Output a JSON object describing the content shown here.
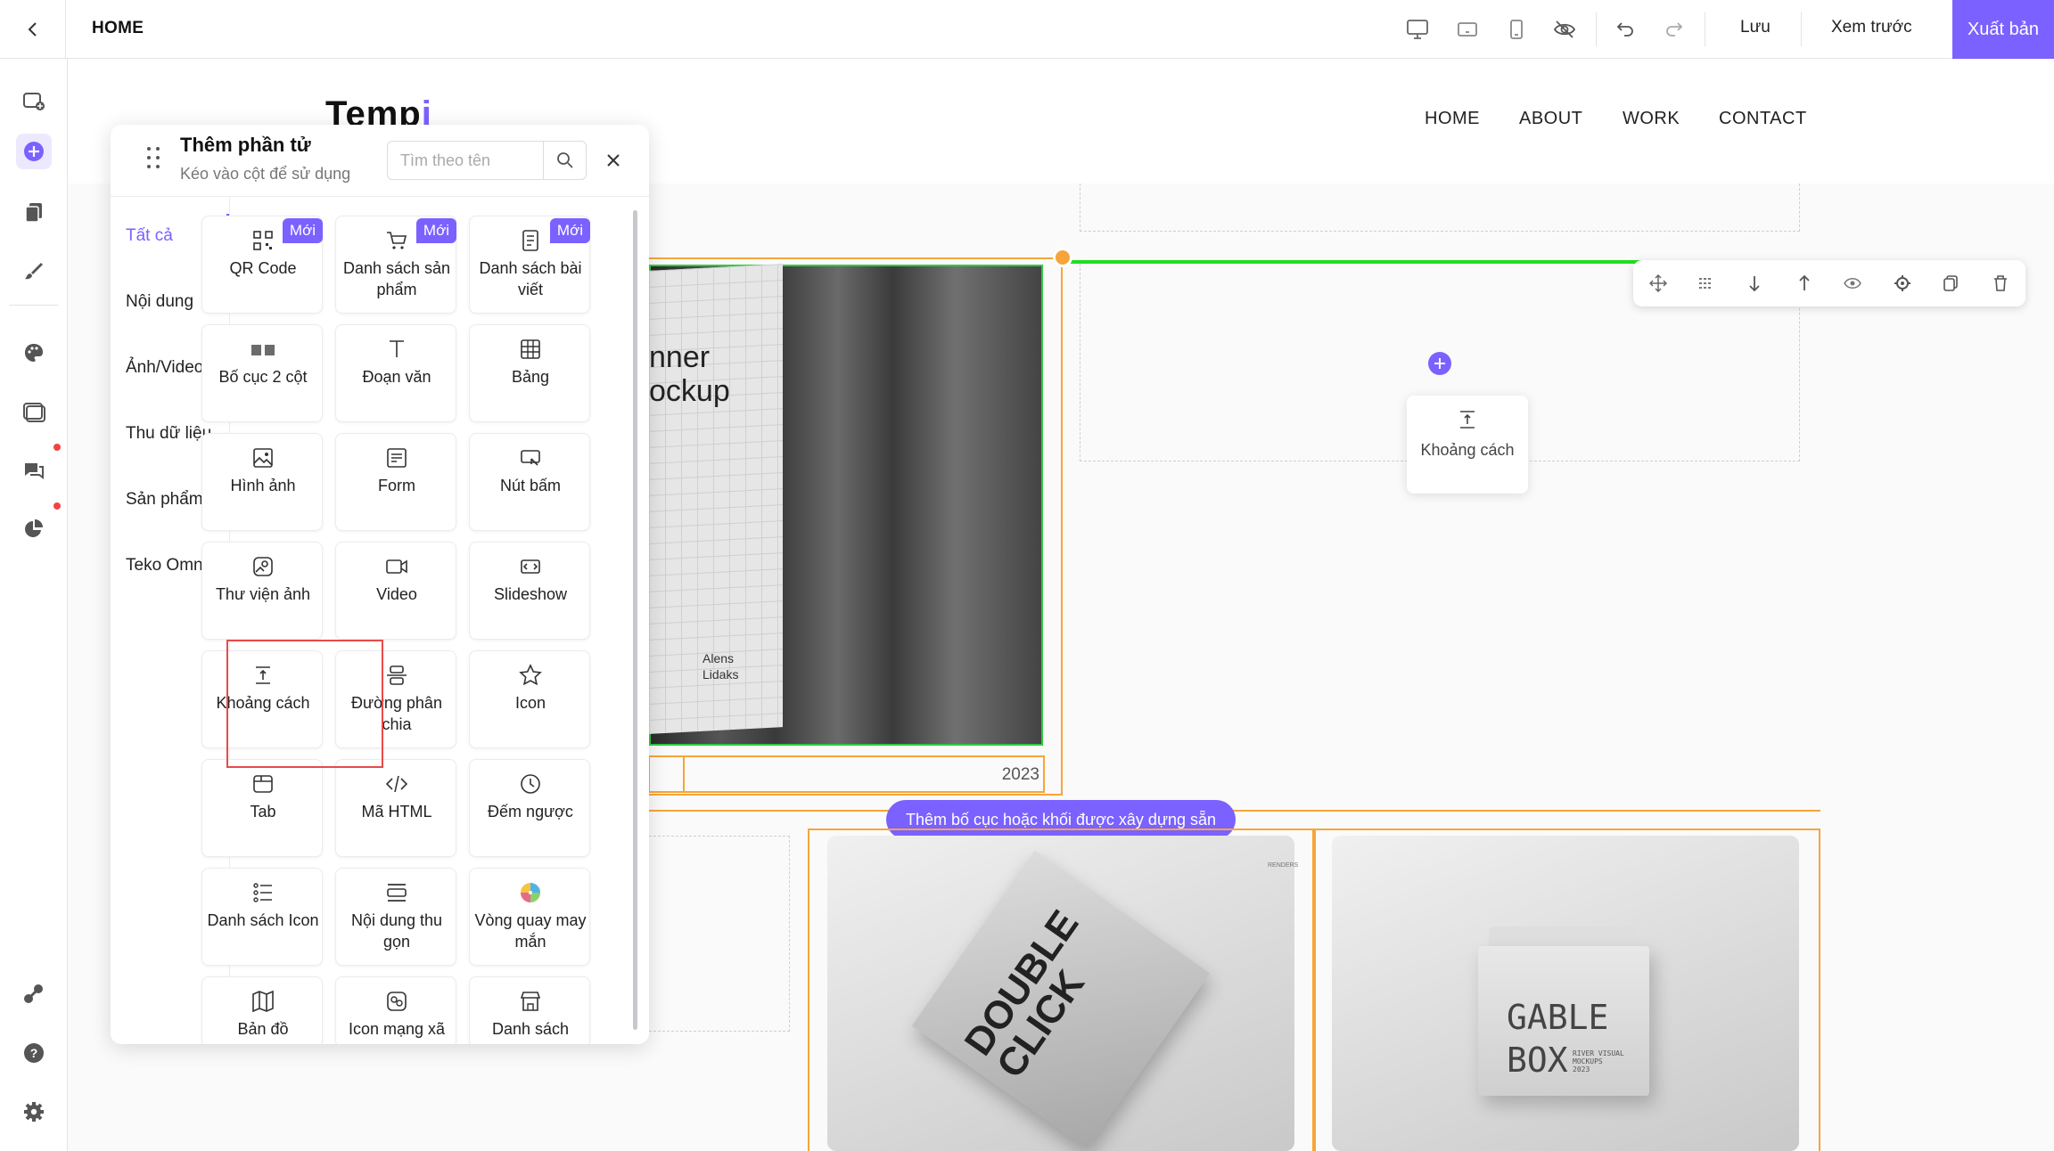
{
  "topbar": {
    "page_name": "HOME",
    "save_label": "Lưu",
    "preview_label": "Xem trước",
    "publish_label": "Xuất bản"
  },
  "site": {
    "logo": "Temp",
    "logo_accent": "i",
    "nav": [
      "HOME",
      "ABOUT",
      "WORK",
      "CONTACT"
    ],
    "banner_line1": "nner",
    "banner_line2": "ockup",
    "banner_author": "Alens\nLidaks",
    "year": "2023",
    "add_layout_label": "Thêm bố cục hoặc khối được xây dựng sẵn",
    "drag_card_label": "Khoảng cách",
    "double_click": "DOUBLE\nCLICK",
    "gable_box": "GABLE\nBOX",
    "gable_box_small": "RIVER VISUAL\nMOCKUPS\n2023",
    "renders_small": "RENDERS"
  },
  "panel": {
    "title": "Thêm phần tử",
    "subtitle": "Kéo vào cột để sử dụng",
    "search_placeholder": "Tìm theo tên",
    "categories": [
      "Tất cả",
      "Nội dung",
      "Ảnh/Video",
      "Thu dữ liệu",
      "Sản phẩm",
      "Teko Omni"
    ],
    "badge_label": "Mới",
    "tiles": [
      {
        "label": "QR Code",
        "icon": "qr-icon",
        "badge": true
      },
      {
        "label": "Danh sách sản phẩm",
        "icon": "cart-icon",
        "badge": true
      },
      {
        "label": "Danh sách bài viết",
        "icon": "document-icon",
        "badge": true
      },
      {
        "label": "Bố cục 2 cột",
        "icon": "two-columns-icon",
        "badge": false
      },
      {
        "label": "Đoạn văn",
        "icon": "text-icon",
        "badge": false
      },
      {
        "label": "Bảng",
        "icon": "table-icon",
        "badge": false
      },
      {
        "label": "Hình ảnh",
        "icon": "image-icon",
        "badge": false
      },
      {
        "label": "Form",
        "icon": "form-icon",
        "badge": false
      },
      {
        "label": "Nút bấm",
        "icon": "button-icon",
        "badge": false
      },
      {
        "label": "Thư viện ảnh",
        "icon": "gallery-icon",
        "badge": false
      },
      {
        "label": "Video",
        "icon": "video-icon",
        "badge": false
      },
      {
        "label": "Slideshow",
        "icon": "slideshow-icon",
        "badge": false
      },
      {
        "label": "Khoảng cách",
        "icon": "spacing-icon",
        "badge": false
      },
      {
        "label": "Đường phân chia",
        "icon": "divider-icon",
        "badge": false
      },
      {
        "label": "Icon",
        "icon": "star-icon",
        "badge": false
      },
      {
        "label": "Tab",
        "icon": "tab-icon",
        "badge": false
      },
      {
        "label": "Mã HTML",
        "icon": "code-icon",
        "badge": false
      },
      {
        "label": "Đếm ngược",
        "icon": "clock-icon",
        "badge": false
      },
      {
        "label": "Danh sách Icon",
        "icon": "icon-list-icon",
        "badge": false
      },
      {
        "label": "Nội dung thu gọn",
        "icon": "collapse-icon",
        "badge": false
      },
      {
        "label": "Vòng quay may mắn",
        "icon": "lucky-wheel-icon",
        "badge": false
      },
      {
        "label": "Bản đồ",
        "icon": "map-icon",
        "badge": false
      },
      {
        "label": "Icon mạng xã",
        "icon": "social-icon",
        "badge": false
      },
      {
        "label": "Danh sách",
        "icon": "store-icon",
        "badge": false
      }
    ]
  },
  "colors": {
    "accent": "#7b61ff",
    "selection": "#f6a53a",
    "active_line": "#22dd22",
    "highlight": "#e84a4a",
    "notification": "#ef4444"
  }
}
